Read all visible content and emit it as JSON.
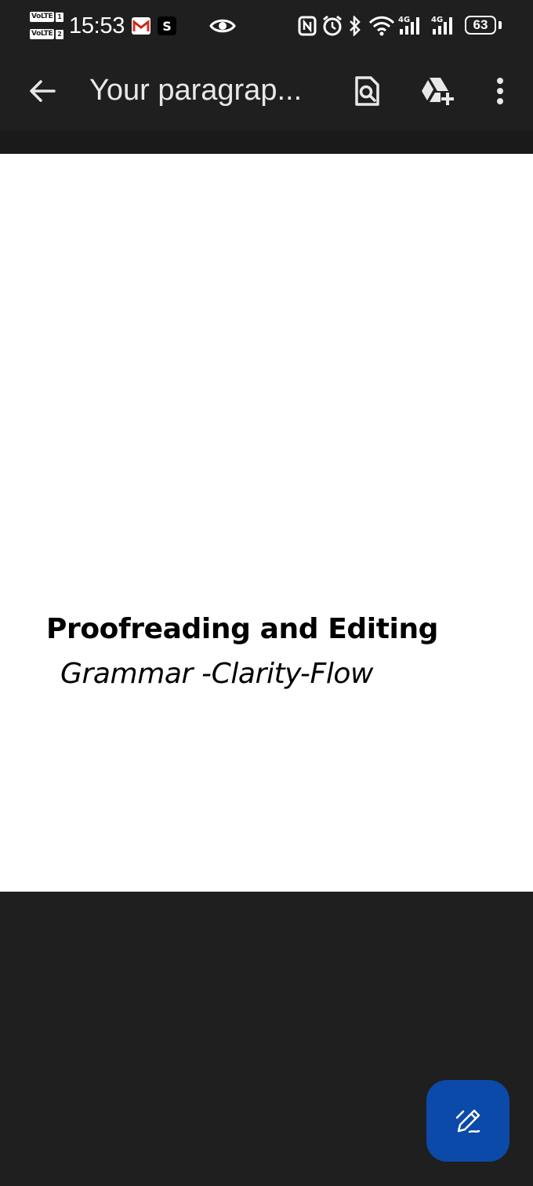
{
  "status_bar": {
    "time": "15:53",
    "sim1_label": "VoLTE",
    "sim1_index": "1",
    "sim2_label": "VoLTE",
    "sim2_index": "2",
    "network1": "4G",
    "network2": "4G",
    "battery_level": "63",
    "notification_icons": [
      "gmail-icon",
      "s-app-icon",
      "eye-icon"
    ],
    "system_icons": [
      "nfc-icon",
      "alarm-icon",
      "bluetooth-icon",
      "wifi-icon",
      "signal-icon",
      "signal-icon",
      "battery-icon"
    ]
  },
  "app_bar": {
    "title": "Your paragrap...",
    "icons": [
      "back-arrow-icon",
      "find-in-page-icon",
      "add-to-drive-icon",
      "more-vert-icon"
    ]
  },
  "document": {
    "heading": "Proofreading and Editing",
    "subheading": "Grammar -Clarity-Flow"
  },
  "fab": {
    "icon": "edit-pencil-icon"
  },
  "colors": {
    "background": "#1f1f1f",
    "page": "#ffffff",
    "fab": "#0b4aa8",
    "title_text": "#e8e8e8"
  }
}
